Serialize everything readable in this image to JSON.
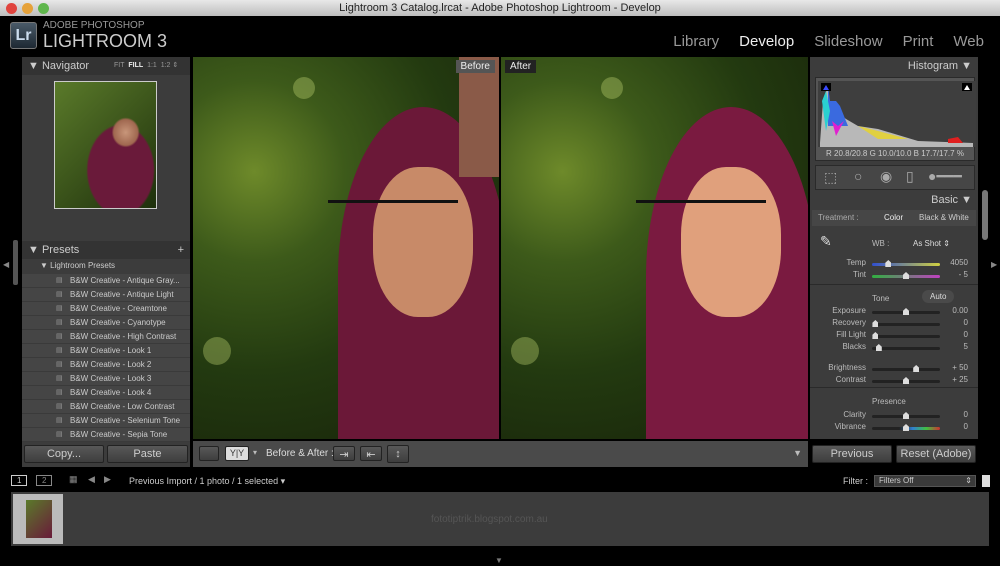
{
  "window_title": "Lightroom 3 Catalog.lrcat - Adobe Photoshop Lightroom - Develop",
  "brand": {
    "logo": "Lr",
    "line1": "ADOBE PHOTOSHOP",
    "line2": "LIGHTROOM 3"
  },
  "modules": [
    "Library",
    "Develop",
    "Slideshow",
    "Print",
    "Web"
  ],
  "active_module": "Develop",
  "navigator": {
    "title": "Navigator",
    "zoom": [
      "FIT",
      "FILL",
      "1:1",
      "1:2"
    ]
  },
  "presets": {
    "title": "Presets",
    "add": "+",
    "folder": "Lightroom Presets",
    "items": [
      "B&W Creative - Antique Gray...",
      "B&W Creative - Antique Light",
      "B&W Creative - Creamtone",
      "B&W Creative - Cyanotype",
      "B&W Creative - High Contrast",
      "B&W Creative - Look 1",
      "B&W Creative - Look 2",
      "B&W Creative - Look 3",
      "B&W Creative - Look 4",
      "B&W Creative - Low Contrast",
      "B&W Creative - Selenium Tone",
      "B&W Creative - Sepia Tone"
    ]
  },
  "left_buttons": {
    "copy": "Copy...",
    "paste": "Paste"
  },
  "view": {
    "before": "Before",
    "after": "After",
    "toolbar_label": "Before & After :",
    "yy": "Y|Y"
  },
  "histogram": {
    "title": "Histogram",
    "readout_r": "R 20.8/20.8",
    "readout_g": "G 10.0/10.0",
    "readout_b": "B 17.7/17.7",
    "pct": "%"
  },
  "basic": {
    "title": "Basic",
    "treatment_label": "Treatment :",
    "color": "Color",
    "bw": "Black & White",
    "wb_label": "WB :",
    "wb_value": "As Shot",
    "tone": "Tone",
    "auto": "Auto",
    "presence": "Presence",
    "sliders": [
      {
        "label": "Temp",
        "value": "4050",
        "pos": 0.24
      },
      {
        "label": "Tint",
        "value": "- 5",
        "pos": 0.5
      },
      {
        "label": "Exposure",
        "value": "0.00",
        "pos": 0.5
      },
      {
        "label": "Recovery",
        "value": "0",
        "pos": 0.05
      },
      {
        "label": "Fill Light",
        "value": "0",
        "pos": 0.05
      },
      {
        "label": "Blacks",
        "value": "5",
        "pos": 0.1
      },
      {
        "label": "Brightness",
        "value": "+ 50",
        "pos": 0.65
      },
      {
        "label": "Contrast",
        "value": "+ 25",
        "pos": 0.5
      },
      {
        "label": "Clarity",
        "value": "0",
        "pos": 0.5
      },
      {
        "label": "Vibrance",
        "value": "0",
        "pos": 0.5
      }
    ]
  },
  "right_buttons": {
    "previous": "Previous",
    "reset": "Reset (Adobe)"
  },
  "filmstrip": {
    "screen1": "1",
    "screen2": "2",
    "source": "Previous Import / 1 photo / 1 selected",
    "filter_label": "Filter :",
    "filter_value": "Filters Off",
    "watermark": "fototiptrik.blogspot.com.au"
  }
}
